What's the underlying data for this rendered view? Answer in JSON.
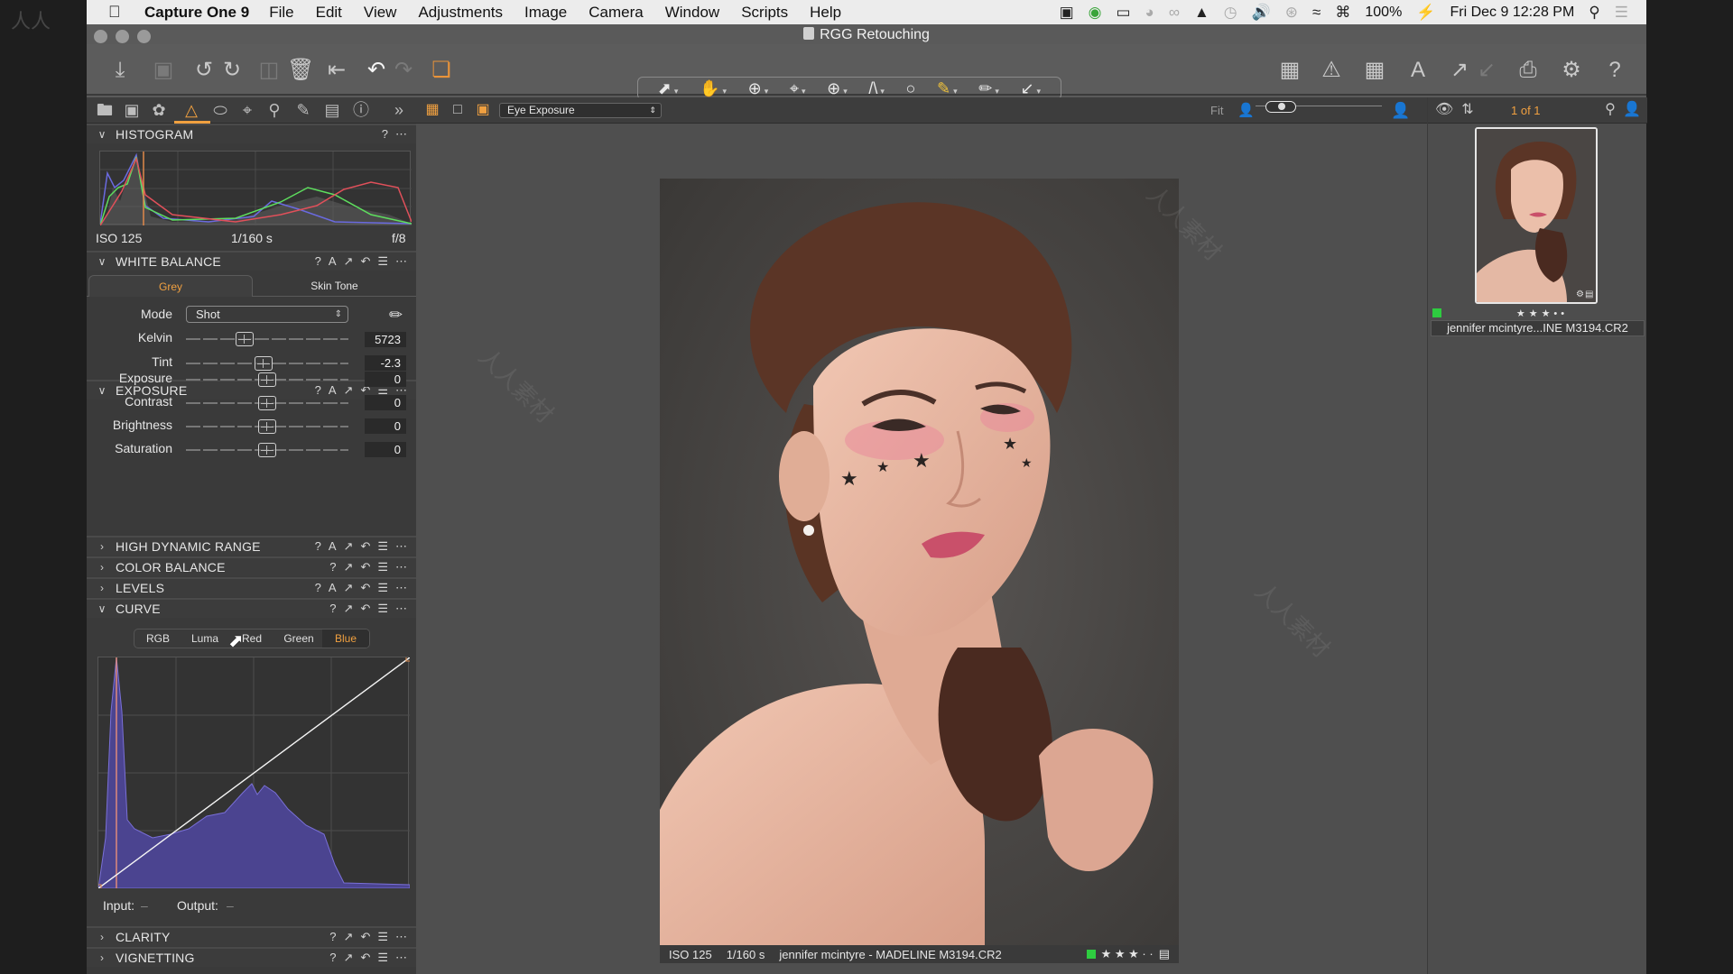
{
  "menubar": {
    "app_name": "Capture One 9",
    "items": [
      "File",
      "Edit",
      "View",
      "Adjustments",
      "Image",
      "Camera",
      "Window",
      "Scripts",
      "Help"
    ],
    "battery": "100%",
    "datetime": "Fri Dec 9  12:28 PM"
  },
  "window": {
    "title": "RGG Retouching"
  },
  "left_panel": {
    "histogram": {
      "title": "HISTOGRAM",
      "iso": "ISO 125",
      "shutter": "1/160 s",
      "aperture": "f/8"
    },
    "white_balance": {
      "title": "WHITE BALANCE",
      "tabs": [
        "Grey",
        "Skin Tone"
      ],
      "active_tab": "Grey",
      "mode_label": "Mode",
      "mode_value": "Shot",
      "kelvin_label": "Kelvin",
      "kelvin_value": "5723",
      "kelvin_position": 0.36,
      "tint_label": "Tint",
      "tint_value": "-2.3",
      "tint_position": 0.48
    },
    "exposure": {
      "title": "EXPOSURE",
      "rows": [
        {
          "label": "Exposure",
          "value": "0",
          "position": 0.5
        },
        {
          "label": "Contrast",
          "value": "0",
          "position": 0.5
        },
        {
          "label": "Brightness",
          "value": "0",
          "position": 0.5
        },
        {
          "label": "Saturation",
          "value": "0",
          "position": 0.5
        }
      ]
    },
    "collapsed_sections": [
      "HIGH DYNAMIC RANGE",
      "COLOR BALANCE",
      "LEVELS"
    ],
    "curve": {
      "title": "CURVE",
      "tabs": [
        "RGB",
        "Luma",
        "Red",
        "Green",
        "Blue"
      ],
      "active_tab": "Blue",
      "input_label": "Input:",
      "input_value": "–",
      "output_label": "Output:",
      "output_value": "–"
    },
    "bottom_sections": [
      "CLARITY",
      "VIGNETTING"
    ]
  },
  "viewer": {
    "variant_select": "Eye Exposure",
    "fit_label": "Fit",
    "zoom_position": 0.1,
    "info": {
      "iso": "ISO 125",
      "shutter": "1/160 s",
      "filename": "jennifer mcintyre - MADELINE M3194.CR2",
      "stars": "★ ★ ★ · ·"
    }
  },
  "browser": {
    "count": "1 of 1",
    "thumb_stars": "★★★••",
    "thumb_name": "jennifer mcintyre...INE M3194.CR2",
    "color_tag": "#2ecc40"
  },
  "colors": {
    "accent": "#f0a040"
  }
}
